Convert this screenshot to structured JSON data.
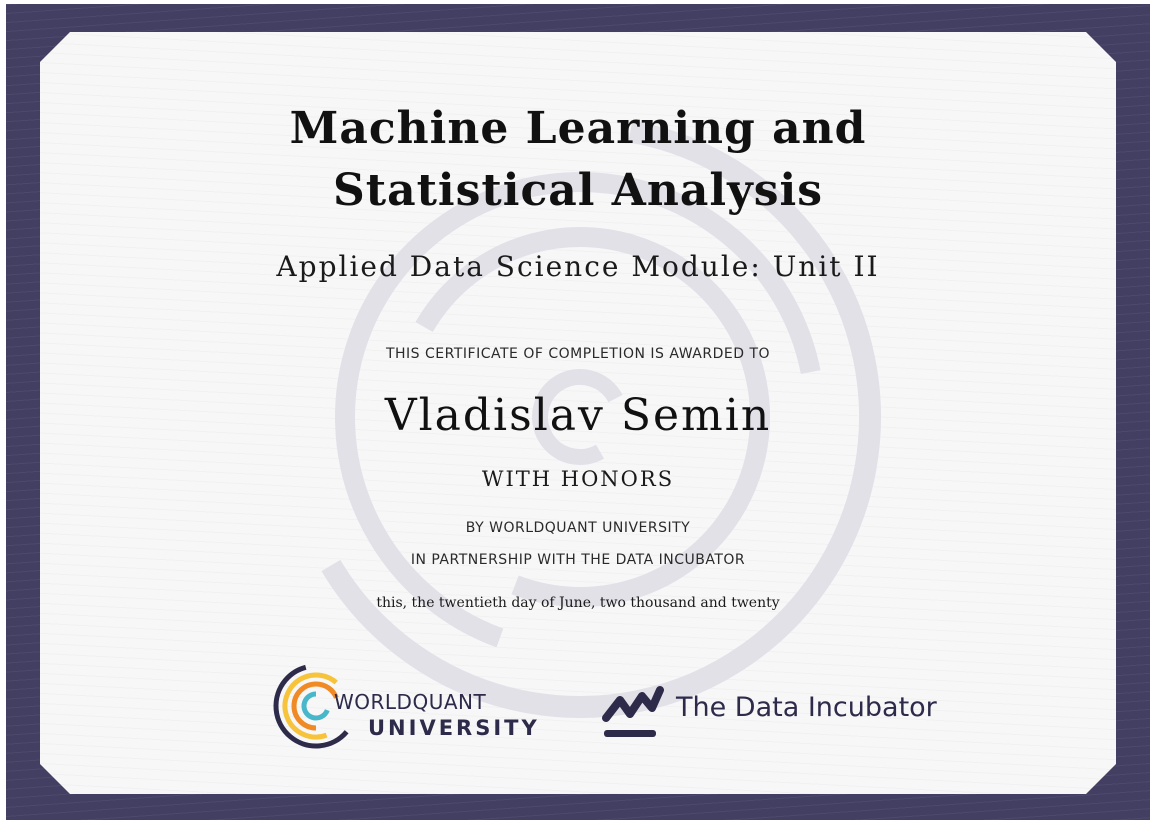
{
  "certificate": {
    "title_line1": "Machine Learning and",
    "title_line2": "Statistical Analysis",
    "subtitle": "Applied Data Science Module: Unit II",
    "awarded_text": "THIS CERTIFICATE OF COMPLETION IS AWARDED TO",
    "recipient": "Vladislav Semin",
    "distinction": "WITH HONORS",
    "issuer_line": "BY WORLDQUANT UNIVERSITY",
    "partner_line": "IN PARTNERSHIP WITH THE DATA INCUBATOR",
    "date_line": "this, the twentieth day of June, two thousand and twenty"
  },
  "logos": {
    "worldquant": {
      "line1": "WORLDQUANT",
      "line2": "UNIVERSITY"
    },
    "data_incubator": {
      "name": "The Data Incubator"
    }
  },
  "colors": {
    "frame": "#433f63",
    "paper": "#f7f7f8",
    "ink": "#111111",
    "logo_navy": "#2d2a4a",
    "accent_orange": "#f08a24",
    "accent_yellow": "#f6c33b",
    "accent_teal": "#47b7c9"
  }
}
